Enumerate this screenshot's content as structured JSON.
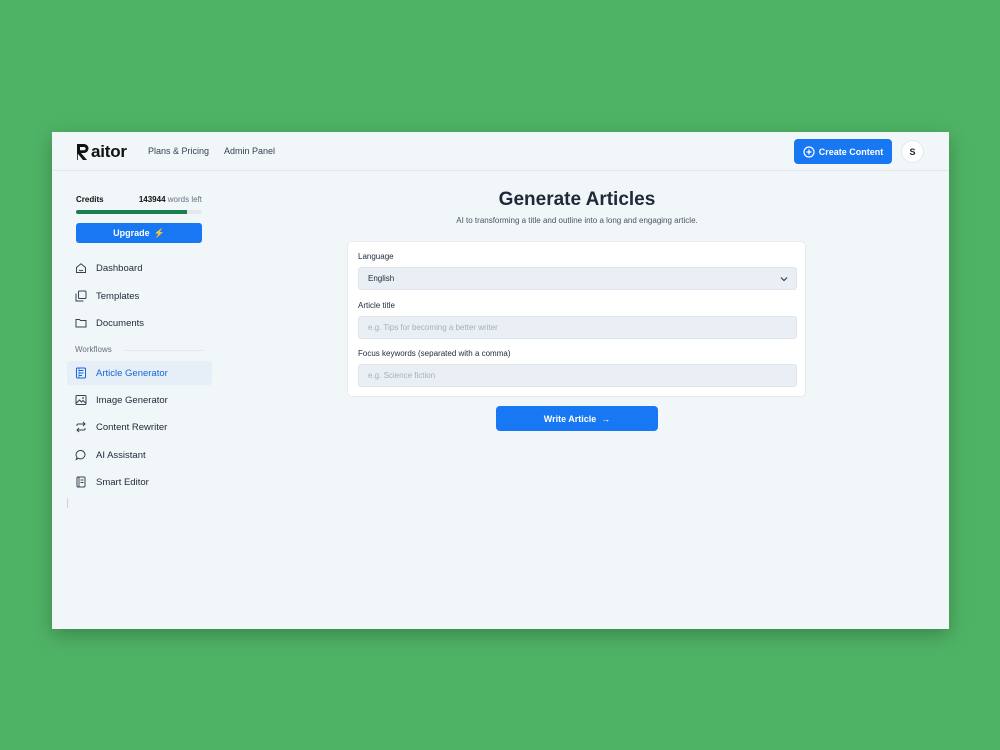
{
  "app": {
    "logo_text": "aitor"
  },
  "header": {
    "nav": [
      "Plans & Pricing",
      "Admin Panel"
    ],
    "create_button": "Create Content",
    "avatar_initial": "S"
  },
  "sidebar": {
    "credits_label": "Credits",
    "credits_count": "143944",
    "credits_suffix": "words left",
    "credits_fraction": 0.88,
    "upgrade_label": "Upgrade",
    "upgrade_icon": "⚡",
    "items": [
      {
        "label": "Dashboard",
        "icon": "home-icon"
      },
      {
        "label": "Templates",
        "icon": "templates-icon"
      },
      {
        "label": "Documents",
        "icon": "folder-icon"
      }
    ],
    "workflows_label": "Workflows",
    "workflows": [
      {
        "label": "Article Generator",
        "icon": "article-icon",
        "active": true
      },
      {
        "label": "Image Generator",
        "icon": "image-icon"
      },
      {
        "label": "Content Rewriter",
        "icon": "rewrite-icon"
      },
      {
        "label": "AI Assistant",
        "icon": "chat-icon"
      },
      {
        "label": "Smart Editor",
        "icon": "editor-icon"
      }
    ]
  },
  "main": {
    "title": "Generate Articles",
    "subtitle": "AI to transforming a title and outline into a long and engaging article.",
    "language_label": "Language",
    "language_value": "English",
    "title_label": "Article title",
    "title_placeholder": "e.g. Tips for becoming a better writer",
    "keywords_label": "Focus keywords (separated with a comma)",
    "keywords_placeholder": "e.g. Science fiction",
    "submit_label": "Write Article",
    "submit_arrow": "→"
  },
  "colors": {
    "background": "#4fb365",
    "accent": "#1877f2",
    "credits_bar": "#1a7f4e",
    "active_item": "#1466d8"
  }
}
